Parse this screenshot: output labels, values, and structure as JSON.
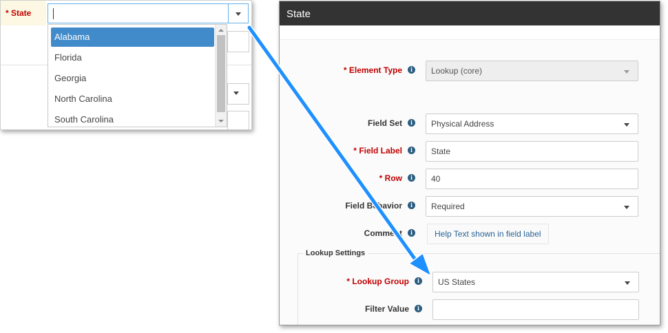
{
  "left_preview": {
    "field_label": "* State",
    "input_value": "",
    "options": [
      {
        "label": "Alabama",
        "selected": true
      },
      {
        "label": "Florida",
        "selected": false
      },
      {
        "label": "Georgia",
        "selected": false
      },
      {
        "label": "North Carolina",
        "selected": false
      },
      {
        "label": "South Carolina",
        "selected": false
      }
    ]
  },
  "panel": {
    "title": "State",
    "fields": {
      "element_type": {
        "label": "Element Type",
        "required": true,
        "value": "Lookup (core)",
        "disabled": true
      },
      "field_set": {
        "label": "Field Set",
        "required": false,
        "value": "Physical Address"
      },
      "field_label": {
        "label": "Field Label",
        "required": true,
        "value": "State"
      },
      "row": {
        "label": "Row",
        "required": true,
        "value": "40"
      },
      "field_behavior": {
        "label": "Field Behavior",
        "required": false,
        "value": "Required"
      },
      "comment": {
        "label": "Comment",
        "required": false,
        "value": "Help Text shown in field label"
      }
    },
    "lookup_settings": {
      "title": "Lookup Settings",
      "lookup_group": {
        "label": "Lookup Group",
        "required": true,
        "value": "US States"
      },
      "filter_value": {
        "label": "Filter Value",
        "required": false,
        "value": ""
      }
    },
    "required_marker": "*",
    "info_glyph": "i"
  },
  "colors": {
    "required": "#c00000",
    "header": "#333333",
    "selection": "#428bca",
    "focus": "#66afe9",
    "arrow": "#1e90ff",
    "info": "#2b5d80"
  },
  "icons": [
    "chevron-down-icon",
    "info-icon",
    "scroll-up-icon",
    "scroll-down-icon",
    "arrow-annotation"
  ]
}
